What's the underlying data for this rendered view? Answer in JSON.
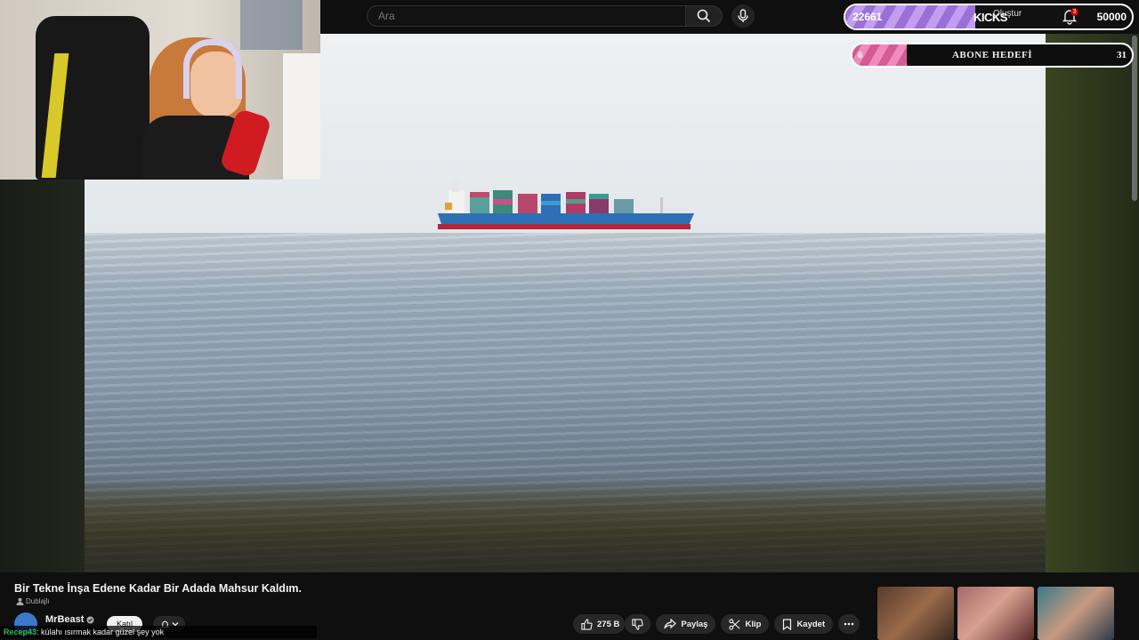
{
  "search": {
    "placeholder": "Ara"
  },
  "header": {
    "create_label": "Oluştur",
    "notification_count": "3"
  },
  "kicks_goal": {
    "current": "22661",
    "label": "KICKS",
    "target": "50000",
    "progress": 0.4532
  },
  "subscriber_goal": {
    "current": "6",
    "label": "ABONE HEDEFİ",
    "target": "31",
    "progress": 0.1935
  },
  "video": {
    "title": "Bir Tekne İnşa Edene Kadar Bir Adada Mahsur Kaldım.",
    "badge": "Dublajlı"
  },
  "channel": {
    "name": "MrBeast",
    "join_label": "Katıl"
  },
  "actions": {
    "likes": "275 B",
    "share": "Paylaş",
    "clip": "Klip",
    "save": "Kaydet"
  },
  "chat": {
    "user": "Recep43",
    "message": ": külahı ısırmak kadar güzel şey yok"
  },
  "colors": {
    "kicks": "#b48be8",
    "subscribers": "#e86fa8",
    "chat_user": "#2ebd59"
  }
}
